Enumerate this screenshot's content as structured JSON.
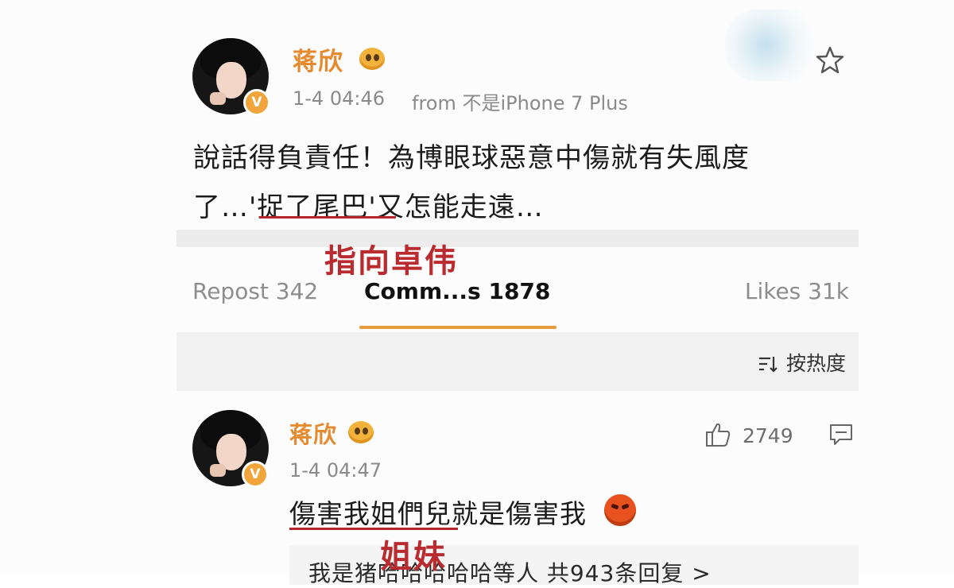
{
  "post": {
    "username": "蒋欣",
    "timestamp": "1-4 04:46",
    "source": "from 不是iPhone 7 Plus",
    "text_line1": "說話得負責任！為博眼球惡意中傷就有失風度",
    "text_line2": "了…'捉了尾巴'又怎能走遠…",
    "verified_badge": "V"
  },
  "annotations": {
    "top": "指向卓伟",
    "bottom": "姐妹"
  },
  "stats": {
    "repost_label": "Repost 342",
    "comments_label": "Comm...s 1878",
    "likes_label": "Likes 31k"
  },
  "sort": {
    "label": "按热度"
  },
  "comment": {
    "username": "蒋欣",
    "timestamp": "1-4 04:47",
    "text": "傷害我姐們兒就是傷害我",
    "like_count": "2749",
    "verified_badge": "V"
  },
  "reply_preview": {
    "text": "我是猪哈哈哈哈哈等人  共943条回复 >"
  },
  "colors": {
    "username": "#e58a2e",
    "annotation": "#b92b2f",
    "tab_underline": "#e79a3a",
    "verified": "#f2a53a"
  },
  "icons": [
    "star-icon",
    "like-icon",
    "reply-icon",
    "sort-icon",
    "angry-emoji",
    "emoji-badge"
  ]
}
